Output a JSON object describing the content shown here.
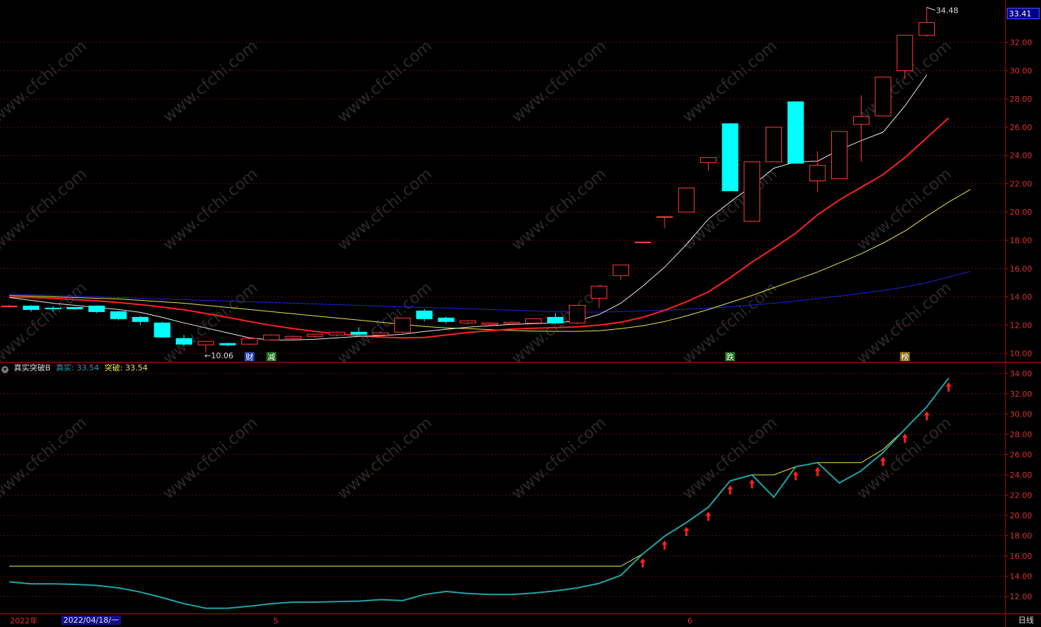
{
  "colors": {
    "background": "#000000",
    "frame": "#aa1111",
    "grid": "#5a0c0c",
    "up_candle": "#ff3c3c",
    "down_candle": "#00ffff",
    "ma5": "#e8e8e8",
    "ma10": "#ff2020",
    "ma20": "#e6e64a",
    "ma60": "#2020e0",
    "real_line": "#1fa4a4",
    "breakout_line": "#e8e84c",
    "axis_text": "#dd3030",
    "date_text": "#dd3030",
    "selected_date_bg": "#10108a",
    "arrow": "#ff2020"
  },
  "chart_data": [
    {
      "type": "candlestick",
      "name": "main",
      "ylim": [
        9.4,
        35.0
      ],
      "yticks": [
        10,
        12,
        14,
        16,
        18,
        20,
        22,
        24,
        26,
        28,
        30,
        32
      ],
      "ytick_labels": [
        "10.00",
        "12.00",
        "14.00",
        "16.00",
        "18.00",
        "20.00",
        "22.00",
        "24.00",
        "26.00",
        "28.00",
        "30.00",
        "32.00"
      ],
      "last_price_label": "33.41",
      "high_annotation": "34.48",
      "low_annotation": "10.06",
      "candles": [
        {
          "o": 13.35,
          "h": 13.45,
          "l": 13.25,
          "c": 13.35
        },
        {
          "o": 13.35,
          "h": 13.4,
          "l": 12.95,
          "c": 13.1
        },
        {
          "o": 13.2,
          "h": 13.35,
          "l": 12.95,
          "c": 13.15
        },
        {
          "o": 13.25,
          "h": 13.25,
          "l": 13.1,
          "c": 13.15
        },
        {
          "o": 13.35,
          "h": 13.4,
          "l": 12.85,
          "c": 12.95
        },
        {
          "o": 12.95,
          "h": 13.0,
          "l": 12.35,
          "c": 12.45
        },
        {
          "o": 12.55,
          "h": 12.65,
          "l": 12.0,
          "c": 12.25
        },
        {
          "o": 12.15,
          "h": 12.25,
          "l": 11.1,
          "c": 11.15
        },
        {
          "o": 11.05,
          "h": 11.3,
          "l": 10.55,
          "c": 10.65
        },
        {
          "o": 10.6,
          "h": 10.85,
          "l": 10.06,
          "c": 10.85
        },
        {
          "o": 10.7,
          "h": 10.75,
          "l": 10.5,
          "c": 10.6
        },
        {
          "o": 10.65,
          "h": 11.1,
          "l": 10.6,
          "c": 11.05
        },
        {
          "o": 10.95,
          "h": 11.35,
          "l": 10.9,
          "c": 11.3
        },
        {
          "o": 11.05,
          "h": 11.25,
          "l": 10.95,
          "c": 11.2
        },
        {
          "o": 11.2,
          "h": 11.4,
          "l": 11.1,
          "c": 11.35
        },
        {
          "o": 11.3,
          "h": 11.55,
          "l": 11.2,
          "c": 11.5
        },
        {
          "o": 11.5,
          "h": 11.85,
          "l": 11.3,
          "c": 11.35
        },
        {
          "o": 11.3,
          "h": 11.55,
          "l": 11.25,
          "c": 11.45
        },
        {
          "o": 11.5,
          "h": 12.5,
          "l": 11.4,
          "c": 12.5
        },
        {
          "o": 13.0,
          "h": 13.15,
          "l": 12.25,
          "c": 12.45
        },
        {
          "o": 12.5,
          "h": 12.6,
          "l": 12.1,
          "c": 12.25
        },
        {
          "o": 12.15,
          "h": 12.35,
          "l": 12.05,
          "c": 12.3
        },
        {
          "o": 12.05,
          "h": 12.2,
          "l": 11.95,
          "c": 12.15
        },
        {
          "o": 12.1,
          "h": 12.25,
          "l": 12.05,
          "c": 12.2
        },
        {
          "o": 12.15,
          "h": 12.5,
          "l": 12.1,
          "c": 12.45
        },
        {
          "o": 12.55,
          "h": 12.85,
          "l": 12.05,
          "c": 12.15
        },
        {
          "o": 12.15,
          "h": 13.4,
          "l": 12.05,
          "c": 13.4
        },
        {
          "o": 13.9,
          "h": 14.75,
          "l": 13.2,
          "c": 14.75
        },
        {
          "o": 15.5,
          "h": 16.25,
          "l": 15.2,
          "c": 16.25
        },
        {
          "o": 17.88,
          "h": 17.88,
          "l": 17.88,
          "c": 17.88
        },
        {
          "o": 19.67,
          "h": 19.67,
          "l": 18.85,
          "c": 19.67
        },
        {
          "o": 20.0,
          "h": 21.7,
          "l": 20.0,
          "c": 21.7
        },
        {
          "o": 23.5,
          "h": 23.85,
          "l": 22.95,
          "c": 23.85
        },
        {
          "o": 26.25,
          "h": 26.25,
          "l": 21.5,
          "c": 21.5
        },
        {
          "o": 19.35,
          "h": 23.55,
          "l": 19.35,
          "c": 23.55
        },
        {
          "o": 23.55,
          "h": 26.0,
          "l": 23.55,
          "c": 26.0
        },
        {
          "o": 27.8,
          "h": 27.8,
          "l": 23.45,
          "c": 23.45
        },
        {
          "o": 22.2,
          "h": 24.3,
          "l": 21.4,
          "c": 23.3
        },
        {
          "o": 22.35,
          "h": 25.7,
          "l": 22.35,
          "c": 25.7
        },
        {
          "o": 26.2,
          "h": 28.25,
          "l": 23.55,
          "c": 26.75
        },
        {
          "o": 26.8,
          "h": 29.55,
          "l": 26.8,
          "c": 29.55
        },
        {
          "o": 30.0,
          "h": 32.5,
          "l": 29.4,
          "c": 32.5
        },
        {
          "o": 32.5,
          "h": 34.48,
          "l": 32.4,
          "c": 33.41
        }
      ],
      "ma5": [
        13.95,
        13.75,
        13.55,
        13.4,
        13.25,
        13.1,
        12.9,
        12.55,
        12.15,
        11.8,
        11.45,
        11.1,
        10.95,
        10.95,
        11.0,
        11.1,
        11.2,
        11.25,
        11.35,
        11.55,
        11.7,
        11.85,
        11.95,
        12.05,
        12.1,
        12.15,
        12.3,
        12.75,
        13.55,
        14.75,
        16.1,
        17.7,
        19.5,
        20.7,
        21.85,
        23.1,
        23.55,
        23.6,
        24.4,
        25.05,
        25.65,
        27.5,
        29.7
      ],
      "ma10": [
        13.98,
        13.95,
        13.9,
        13.8,
        13.72,
        13.6,
        13.45,
        13.28,
        13.08,
        12.82,
        12.55,
        12.25,
        11.98,
        11.75,
        11.55,
        11.38,
        11.25,
        11.15,
        11.1,
        11.12,
        11.3,
        11.48,
        11.6,
        11.72,
        11.78,
        11.82,
        11.88,
        12.0,
        12.2,
        12.55,
        13.05,
        13.65,
        14.35,
        15.35,
        16.45,
        17.45,
        18.5,
        19.8,
        20.85,
        21.75,
        22.65,
        23.85,
        25.25,
        26.65
      ],
      "ma20": [
        14.1,
        14.05,
        14.0,
        13.95,
        13.9,
        13.85,
        13.75,
        13.65,
        13.55,
        13.4,
        13.25,
        13.1,
        12.95,
        12.8,
        12.65,
        12.5,
        12.35,
        12.2,
        12.05,
        11.9,
        11.8,
        11.75,
        11.68,
        11.62,
        11.58,
        11.56,
        11.56,
        11.6,
        11.75,
        11.95,
        12.25,
        12.65,
        13.1,
        13.6,
        14.1,
        14.65,
        15.2,
        15.75,
        16.4,
        17.05,
        17.8,
        18.65,
        19.7,
        20.7,
        21.6
      ],
      "ma60": [
        14.2,
        14.15,
        14.1,
        14.05,
        14.0,
        13.95,
        13.9,
        13.85,
        13.8,
        13.75,
        13.7,
        13.65,
        13.6,
        13.55,
        13.5,
        13.45,
        13.4,
        13.35,
        13.3,
        13.25,
        13.2,
        13.15,
        13.1,
        13.05,
        13.0,
        12.95,
        12.92,
        12.92,
        12.95,
        13.0,
        13.05,
        13.12,
        13.2,
        13.3,
        13.42,
        13.55,
        13.7,
        13.88,
        14.05,
        14.25,
        14.45,
        14.7,
        15.0,
        15.4,
        15.8
      ],
      "event_labels": [
        {
          "index": 11,
          "text": "财"
        },
        {
          "index": 12,
          "text": "减"
        },
        {
          "index": 33,
          "text": "跌"
        },
        {
          "index": 41,
          "text": "榜"
        }
      ]
    },
    {
      "type": "line",
      "name": "真实突破B",
      "ylim": [
        10.4,
        35.0
      ],
      "yticks": [
        12,
        14,
        16,
        18,
        20,
        22,
        24,
        26,
        28,
        30,
        32,
        34
      ],
      "ytick_labels": [
        "12.00",
        "14.00",
        "16.00",
        "18.00",
        "20.00",
        "22.00",
        "24.00",
        "26.00",
        "28.00",
        "30.00",
        "32.00",
        "34.00"
      ],
      "series": [
        {
          "name": "真实",
          "values": [
            13.45,
            13.25,
            13.25,
            13.2,
            13.1,
            12.85,
            12.45,
            11.9,
            11.3,
            10.85,
            10.85,
            11.05,
            11.3,
            11.45,
            11.45,
            11.5,
            11.55,
            11.7,
            11.6,
            12.2,
            12.5,
            12.3,
            12.2,
            12.2,
            12.35,
            12.55,
            12.85,
            13.3,
            14.1,
            16.2,
            17.95,
            19.3,
            20.8,
            23.4,
            24.0,
            21.8,
            24.8,
            25.2,
            23.2,
            24.4,
            26.2,
            28.5,
            30.7,
            33.54
          ]
        },
        {
          "name": "突破",
          "values": [
            15.0,
            15.0,
            15.0,
            15.0,
            15.0,
            15.0,
            15.0,
            15.0,
            15.0,
            15.0,
            15.0,
            15.0,
            15.0,
            15.0,
            15.0,
            15.0,
            15.0,
            15.0,
            15.0,
            15.0,
            15.0,
            15.0,
            15.0,
            15.0,
            15.0,
            15.0,
            15.0,
            15.0,
            15.0,
            16.2,
            17.95,
            19.3,
            20.8,
            23.4,
            24.0,
            24.0,
            24.8,
            25.2,
            25.2,
            25.2,
            26.5,
            28.5,
            30.7,
            33.54
          ]
        }
      ],
      "arrow_indices": [
        29,
        30,
        31,
        32,
        33,
        34,
        36,
        37,
        40,
        41,
        42,
        43
      ]
    }
  ],
  "indicator": {
    "title": "真实突破B",
    "real_label": "真实:",
    "real_value": "33.54",
    "breakout_label": "突破:",
    "breakout_value": "33.54"
  },
  "date_axis": {
    "year_label": "2022年",
    "selected_date": "2022/04/18/一",
    "month_5": "5",
    "month_6": "6"
  },
  "period_button": "日线",
  "watermark": "www.cfchi.com"
}
